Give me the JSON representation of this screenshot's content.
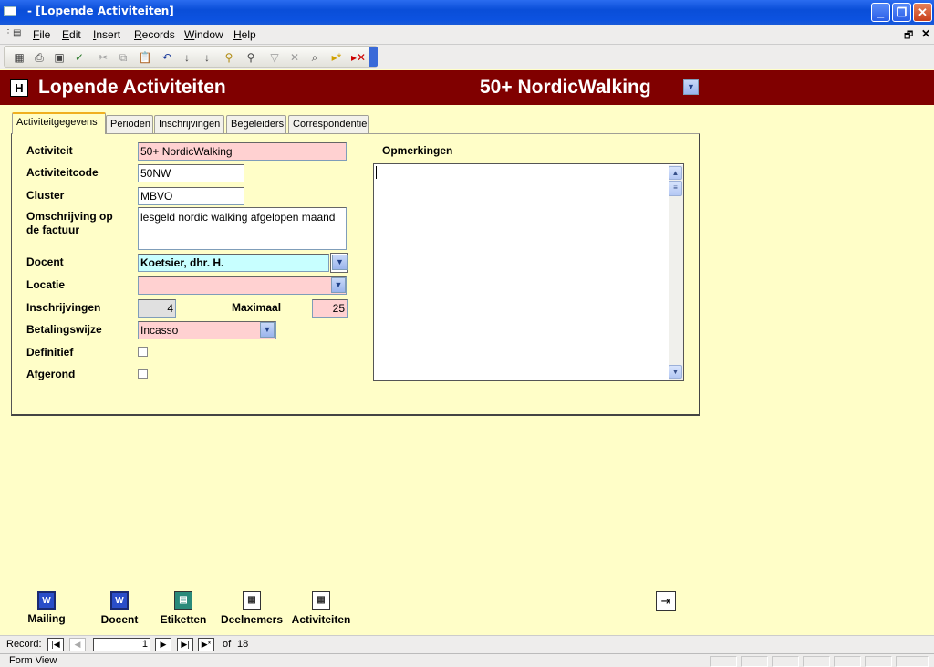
{
  "window": {
    "title": " - [Lopende Activiteiten]"
  },
  "menu": {
    "items": [
      "File",
      "Edit",
      "Insert",
      "Records",
      "Window",
      "Help"
    ]
  },
  "toolbar_icons": [
    "view-icon",
    "print-icon",
    "print-preview-icon",
    "spelling-icon",
    "cut-icon",
    "copy-icon",
    "paste-icon",
    "undo-icon",
    "sort-ascending-icon",
    "sort-descending-icon",
    "filter-by-selection-icon",
    "filter-by-form-icon",
    "apply-filter-icon",
    "remove-filter-icon",
    "find-icon",
    "new-record-icon",
    "delete-record-icon"
  ],
  "header": {
    "title": "Lopende Activiteiten",
    "record_name": "50+ NordicWalking",
    "icon_letter": "H"
  },
  "tabs": [
    "Activiteitgegevens",
    "Perioden",
    "Inschrijvingen",
    "Begeleiders",
    "Correspondentie"
  ],
  "form": {
    "activiteit": {
      "label": "Activiteit",
      "value": "50+ NordicWalking"
    },
    "activiteitcode": {
      "label": "Activiteitcode",
      "value": "50NW"
    },
    "cluster": {
      "label": "Cluster",
      "value": "MBVO"
    },
    "omschrijving": {
      "label": "Omschrijving op de factuur",
      "value": "lesgeld nordic walking afgelopen maand"
    },
    "docent": {
      "label": "Docent",
      "value": "Koetsier, dhr. H."
    },
    "locatie": {
      "label": "Locatie",
      "value": ""
    },
    "inschrijvingen": {
      "label": "Inschrijvingen",
      "value": "4"
    },
    "maximaal": {
      "label": "Maximaal",
      "value": "25"
    },
    "betalingswijze": {
      "label": "Betalingswijze",
      "value": "Incasso"
    },
    "definitief": {
      "label": "Definitief",
      "checked": false
    },
    "afgerond": {
      "label": "Afgerond",
      "checked": false
    },
    "opmerkingen": {
      "label": "Opmerkingen",
      "value": ""
    }
  },
  "buttons": {
    "mailing": "Mailing",
    "docent": "Docent",
    "etiketten": "Etiketten",
    "deelnemers": "Deelnemers",
    "activiteiten": "Activiteiten"
  },
  "navigation": {
    "label": "Record:",
    "current": "1",
    "of_label": "of",
    "total": "18"
  },
  "status": {
    "text": "Form View"
  },
  "colors": {
    "header_bg": "#800000",
    "form_bg": "#fffec8",
    "required_field": "#ffd1d1",
    "docent_field": "#c8ffff"
  }
}
